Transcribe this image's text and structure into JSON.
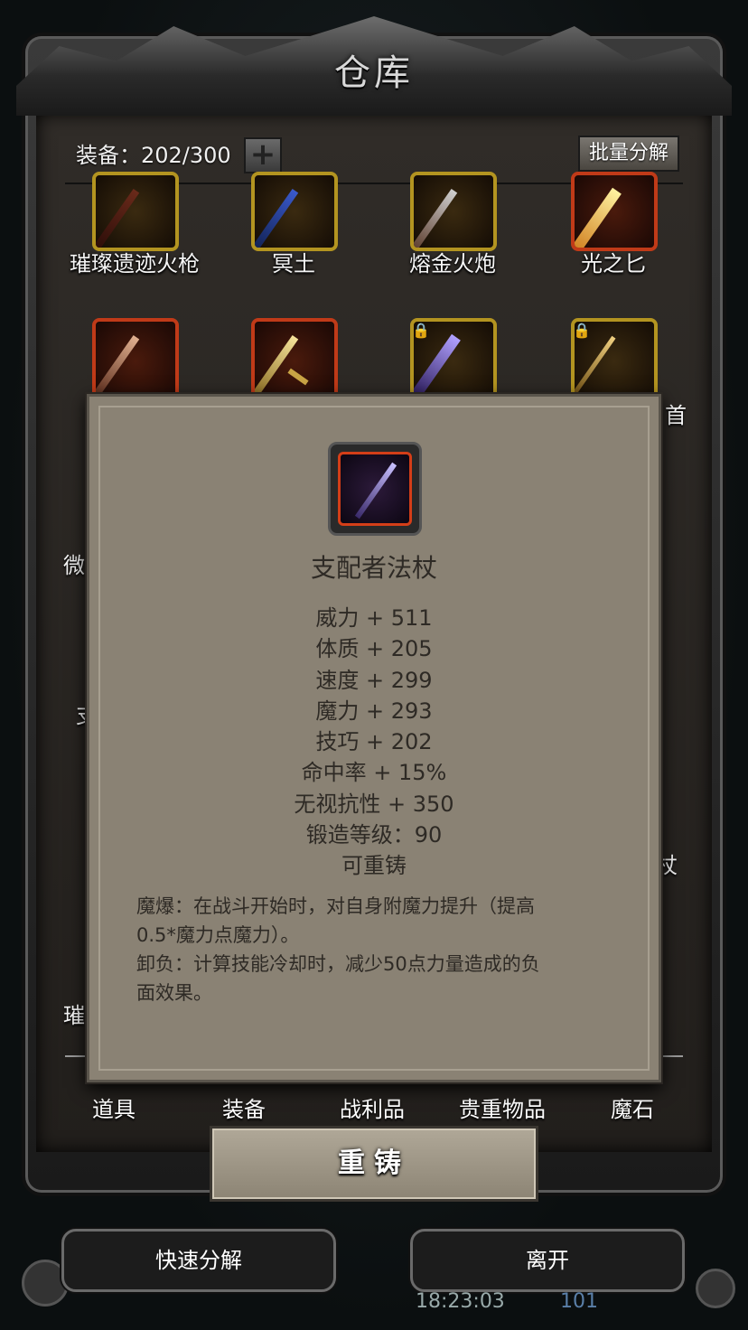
{
  "window": {
    "title": "仓库"
  },
  "header": {
    "count_label": "装备：202/300",
    "plus_icon": "+",
    "batch_label": "批量分解"
  },
  "grid": {
    "row1": [
      {
        "name": "璀璨遗迹火枪",
        "frame": "gold",
        "icon": "rifle-icon"
      },
      {
        "name": "冥土",
        "frame": "gold",
        "icon": "blue-gun-icon"
      },
      {
        "name": "熔金火炮",
        "frame": "gold",
        "icon": "cannon-icon"
      },
      {
        "name": "光之匕",
        "frame": "red",
        "icon": "glowing-dagger-icon"
      }
    ],
    "row2": [
      {
        "frame": "red",
        "icon": "spear-icon",
        "locked": false
      },
      {
        "frame": "red",
        "icon": "gold-dagger-icon",
        "locked": false
      },
      {
        "frame": "gold",
        "icon": "purple-sword-icon",
        "locked": true
      },
      {
        "frame": "gold",
        "icon": "gold-sword-icon",
        "locked": true
      }
    ],
    "side_fragments": [
      "首",
      "微",
      "支",
      "杖",
      "璀"
    ]
  },
  "popup": {
    "icon": "dominator-staff-icon",
    "item_name": "支配者法杖",
    "stats": [
      "威力 + 511",
      "体质 + 205",
      "速度 + 299",
      "魔力 + 293",
      "技巧 + 202",
      "命中率 + 15%",
      "无视抗性 + 350",
      "锻造等级：90",
      "可重铸"
    ],
    "description": [
      "魔爆：在战斗开始时，对自身附魔力提升（提高",
      "0.5*魔力点魔力）。",
      "卸负：计算技能冷却时，减少50点力量造成的负",
      "面效果。"
    ]
  },
  "tabs": [
    "道具",
    "装备",
    "战利品",
    "贵重物品",
    "魔石"
  ],
  "reforge_label": "重铸",
  "bottom": {
    "quick_decompose": "快速分解",
    "leave": "离开",
    "time": "18:23:03",
    "gems": "101"
  }
}
